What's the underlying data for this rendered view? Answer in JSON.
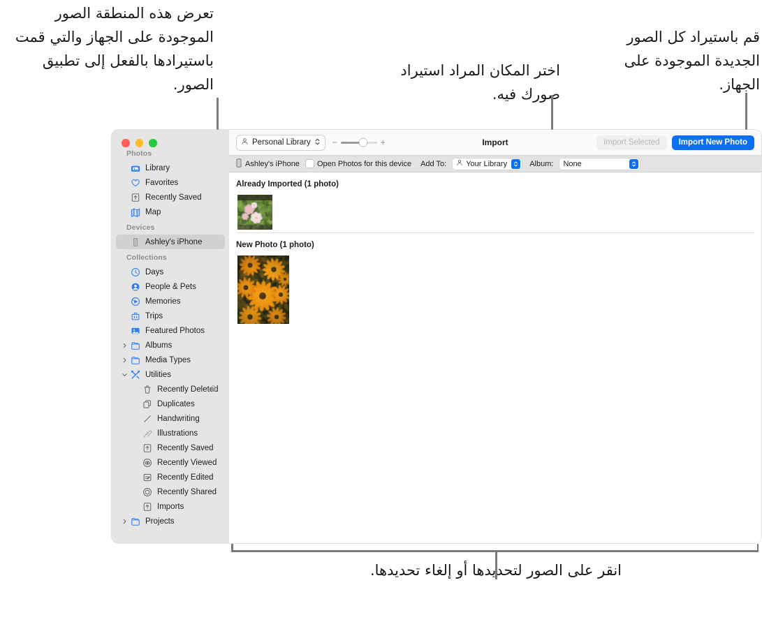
{
  "callouts": {
    "left": "تعرض هذه المنطقة الصور الموجودة على الجهاز والتي قمت باستيرادها بالفعل إلى تطبيق الصور.",
    "middle": "اختر المكان المراد استيراد صورك فيه.",
    "right": "قم باستيراد كل الصور الجديدة الموجودة على الجهاز.",
    "bottom": "انقر على الصور لتحديدها أو إلغاء تحديدها."
  },
  "window": {
    "traffic_lights": {
      "close": "close-button",
      "minimize": "minimize-button",
      "zoom": "zoom-button"
    }
  },
  "toolbar": {
    "library_popup": "Personal Library",
    "zoom_out": "−",
    "zoom_in": "+",
    "zoom_value": 62,
    "title": "Import",
    "import_selected": "Import Selected",
    "import_new": "Import New Photo"
  },
  "importbar": {
    "device": "Ashley's iPhone",
    "open_photos_label": "Open Photos for this device",
    "open_photos_checked": false,
    "add_to_label": "Add To:",
    "add_to_value": "Your Library",
    "album_label": "Album:",
    "album_value": "None"
  },
  "sidebar": {
    "sections": [
      {
        "title": "Photos",
        "items": [
          {
            "label": "Library",
            "icon": "library-icon",
            "selected": false,
            "indent": false,
            "disclosure": null,
            "lock": false
          },
          {
            "label": "Favorites",
            "icon": "heart-icon",
            "selected": false,
            "indent": false,
            "disclosure": null,
            "lock": false
          },
          {
            "label": "Recently Saved",
            "icon": "save-icon",
            "selected": false,
            "indent": false,
            "disclosure": null,
            "lock": false
          },
          {
            "label": "Map",
            "icon": "map-icon",
            "selected": false,
            "indent": false,
            "disclosure": null,
            "lock": false
          }
        ]
      },
      {
        "title": "Devices",
        "items": [
          {
            "label": "Ashley's iPhone",
            "icon": "iphone-icon",
            "selected": true,
            "indent": false,
            "disclosure": null,
            "lock": false
          }
        ]
      },
      {
        "title": "Collections",
        "items": [
          {
            "label": "Days",
            "icon": "clock-icon",
            "selected": false,
            "indent": false,
            "disclosure": null,
            "lock": false
          },
          {
            "label": "People & Pets",
            "icon": "person-circle-icon",
            "selected": false,
            "indent": false,
            "disclosure": null,
            "lock": false
          },
          {
            "label": "Memories",
            "icon": "memories-icon",
            "selected": false,
            "indent": false,
            "disclosure": null,
            "lock": false
          },
          {
            "label": "Trips",
            "icon": "suitcase-icon",
            "selected": false,
            "indent": false,
            "disclosure": null,
            "lock": false
          },
          {
            "label": "Featured Photos",
            "icon": "photo-icon",
            "selected": false,
            "indent": false,
            "disclosure": null,
            "lock": false
          },
          {
            "label": "Albums",
            "icon": "folder-icon",
            "selected": false,
            "indent": false,
            "disclosure": "collapsed",
            "lock": false
          },
          {
            "label": "Media Types",
            "icon": "folder-icon",
            "selected": false,
            "indent": false,
            "disclosure": "collapsed",
            "lock": false
          },
          {
            "label": "Utilities",
            "icon": "tools-icon",
            "selected": false,
            "indent": false,
            "disclosure": "expanded",
            "lock": false
          },
          {
            "label": "Recently Deleted",
            "icon": "trash-icon",
            "selected": false,
            "indent": true,
            "disclosure": null,
            "lock": true
          },
          {
            "label": "Duplicates",
            "icon": "duplicates-icon",
            "selected": false,
            "indent": true,
            "disclosure": null,
            "lock": false
          },
          {
            "label": "Handwriting",
            "icon": "handwriting-icon",
            "selected": false,
            "indent": true,
            "disclosure": null,
            "lock": false
          },
          {
            "label": "Illustrations",
            "icon": "illustrations-icon",
            "selected": false,
            "indent": true,
            "disclosure": null,
            "lock": false
          },
          {
            "label": "Recently Saved",
            "icon": "save-icon",
            "selected": false,
            "indent": true,
            "disclosure": null,
            "lock": false
          },
          {
            "label": "Recently Viewed",
            "icon": "eye-circle-icon",
            "selected": false,
            "indent": true,
            "disclosure": null,
            "lock": false
          },
          {
            "label": "Recently Edited",
            "icon": "edited-icon",
            "selected": false,
            "indent": true,
            "disclosure": null,
            "lock": false
          },
          {
            "label": "Recently Shared",
            "icon": "shared-icon",
            "selected": false,
            "indent": true,
            "disclosure": null,
            "lock": false
          },
          {
            "label": "Imports",
            "icon": "save-icon",
            "selected": false,
            "indent": true,
            "disclosure": null,
            "lock": false
          },
          {
            "label": "Projects",
            "icon": "folder-icon",
            "selected": false,
            "indent": false,
            "disclosure": "collapsed",
            "lock": false
          }
        ]
      }
    ]
  },
  "content": {
    "groups": [
      {
        "header": "Already Imported (1 photo)",
        "photo": "pink-flowers-thumbnail"
      },
      {
        "header": "New Photo (1 photo)",
        "photo": "orange-rudbeckia-flowers-thumbnail"
      }
    ]
  },
  "colors": {
    "accent": "#0b6ff2",
    "sidebar_bg": "#e6e5e5",
    "importbar_bg": "#e3e3e3",
    "leader_line": "#7a7a7a"
  }
}
